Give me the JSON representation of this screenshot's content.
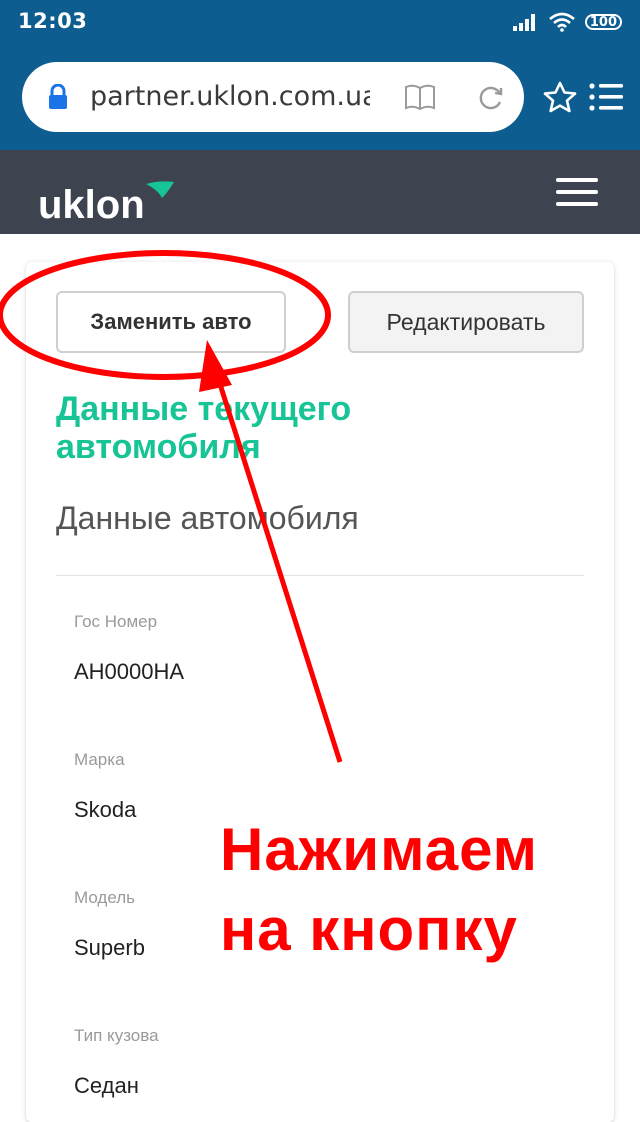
{
  "status_bar": {
    "time": "12:03",
    "battery": "100",
    "icons": [
      "signal-icon",
      "wifi-icon",
      "battery-icon"
    ]
  },
  "browser": {
    "url": "partner.uklon.com.ua/driv",
    "icons": [
      "lock-icon",
      "reader-mode-icon",
      "reload-icon",
      "star-icon",
      "menu-list-icon"
    ]
  },
  "header": {
    "logo_text": "uklon",
    "menu_icon": "hamburger-icon",
    "brand_color": "#3e4350",
    "accent_color": "#16c495"
  },
  "actions": {
    "replace_label": "Заменить авто",
    "edit_label": "Редактировать"
  },
  "content": {
    "current_title": "Данные текущего автомобиля",
    "car_title": "Данные автомобиля",
    "fields": [
      {
        "label": "Гос Номер",
        "value": "АН0000НА"
      },
      {
        "label": "Марка",
        "value": "Skoda"
      },
      {
        "label": "Модель",
        "value": "Superb"
      },
      {
        "label": "Тип кузова",
        "value": "Седан"
      }
    ]
  },
  "annotation": {
    "line1": "Нажимаем",
    "line2": "на кнопку",
    "color": "#ff0000"
  }
}
